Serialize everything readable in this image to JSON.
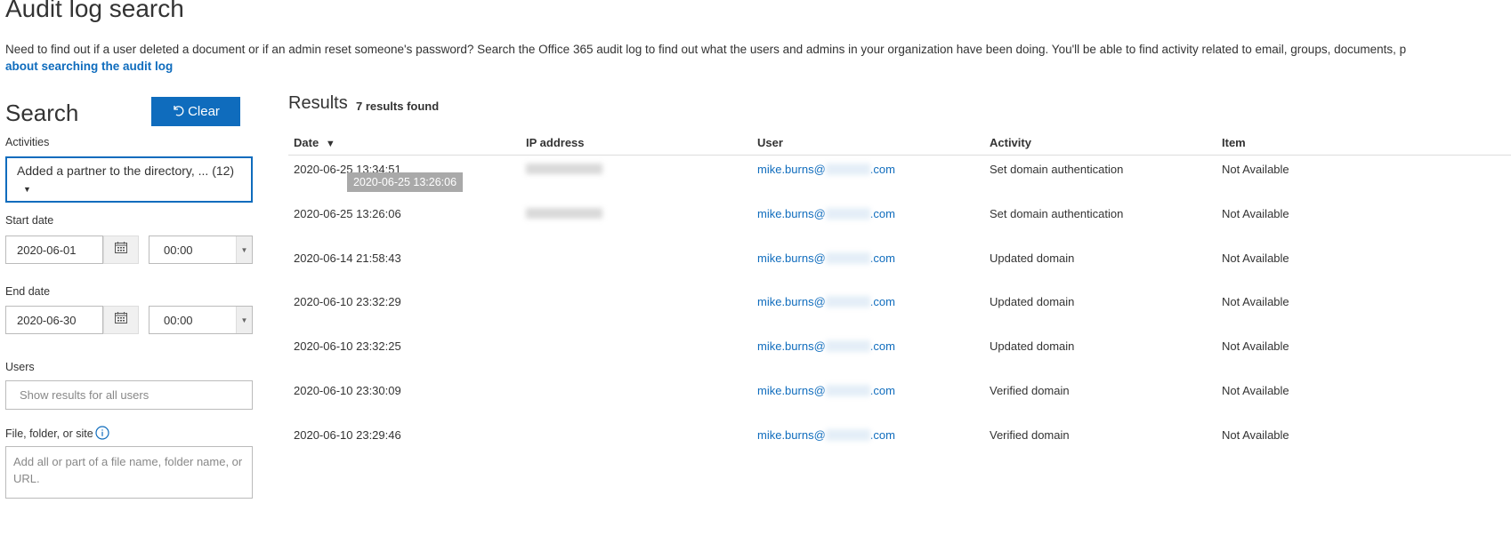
{
  "page": {
    "title": "Audit log search",
    "intro_text": "Need to find out if a user deleted a document or if an admin reset someone's password? Search the Office 365 audit log to find out what the users and admins in your organization have been doing. You'll be able to find activity related to email, groups, documents, p",
    "intro_link": "about searching the audit log"
  },
  "search": {
    "heading": "Search",
    "clear_label": "Clear",
    "activities_label": "Activities",
    "activities_value": "Added a partner to the directory, ... (12)",
    "start_date_label": "Start date",
    "start_date": "2020-06-01",
    "start_time": "00:00",
    "end_date_label": "End date",
    "end_date": "2020-06-30",
    "end_time": "00:00",
    "users_label": "Users",
    "users_placeholder": "Show results for all users",
    "file_label": "File, folder, or site",
    "file_placeholder": "Add all or part of a file name, folder name, or URL."
  },
  "results": {
    "heading": "Results",
    "count": "7 results found",
    "columns": [
      "Date",
      "IP address",
      "User",
      "Activity",
      "Item"
    ],
    "tooltip": "2020-06-25 13:26:06",
    "rows": [
      {
        "date": "2020-06-25 13:34:51",
        "user_prefix": "mike.burns@",
        "user_suffix": ".com",
        "activity": "Set domain authentication",
        "item": "Not Available"
      },
      {
        "date": "2020-06-25 13:26:06",
        "user_prefix": "mike.burns@",
        "user_suffix": ".com",
        "activity": "Set domain authentication",
        "item": "Not Available"
      },
      {
        "date": "2020-06-14 21:58:43",
        "user_prefix": "mike.burns@",
        "user_suffix": ".com",
        "activity": "Updated domain",
        "item": "Not Available"
      },
      {
        "date": "2020-06-10 23:32:29",
        "user_prefix": "mike.burns@",
        "user_suffix": ".com",
        "activity": "Updated domain",
        "item": "Not Available"
      },
      {
        "date": "2020-06-10 23:32:25",
        "user_prefix": "mike.burns@",
        "user_suffix": ".com",
        "activity": "Updated domain",
        "item": "Not Available"
      },
      {
        "date": "2020-06-10 23:30:09",
        "user_prefix": "mike.burns@",
        "user_suffix": ".com",
        "activity": "Verified domain",
        "item": "Not Available"
      },
      {
        "date": "2020-06-10 23:29:46",
        "user_prefix": "mike.burns@",
        "user_suffix": ".com",
        "activity": "Verified domain",
        "item": "Not Available"
      }
    ]
  },
  "icons": {
    "clear": "undo-icon",
    "calendar": "calendar-icon",
    "dropdown": "chevron-down-icon",
    "sort": "sort-descending-icon",
    "info": "info-icon"
  },
  "colors": {
    "accent": "#0f6cbd"
  }
}
